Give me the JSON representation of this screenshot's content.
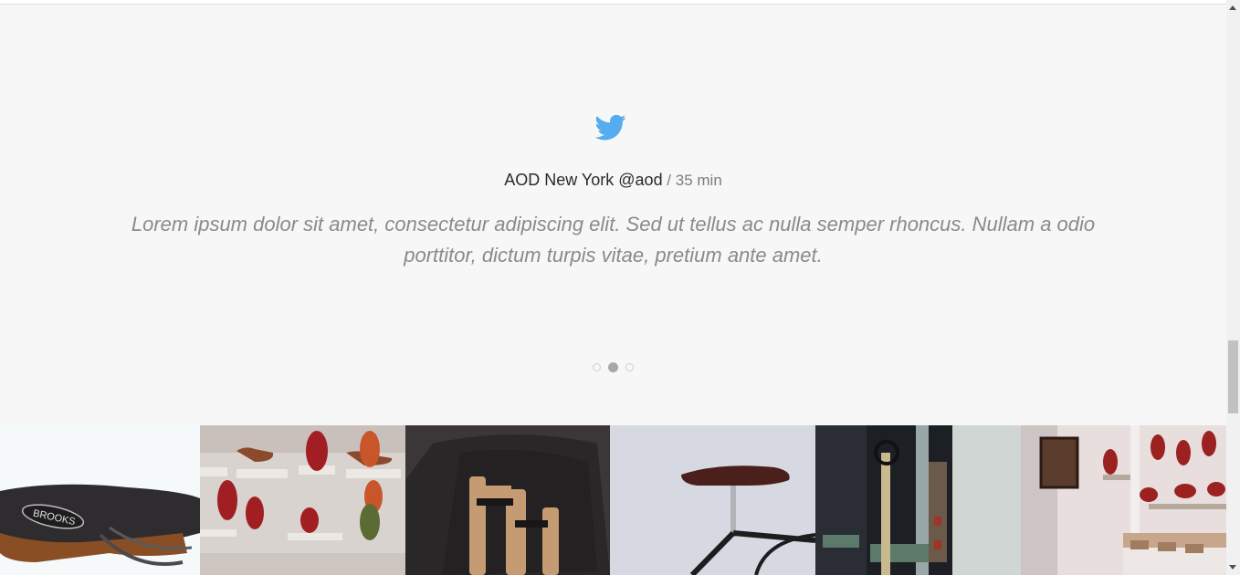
{
  "tweet": {
    "icon": "twitter-bird-icon",
    "author": "AOD New York @aod",
    "separator": " / ",
    "time": "35 min",
    "text": "Lorem ipsum dolor sit amet, consectetur adipiscing elit. Sed ut tellus ac nulla semper rhoncus. Nullam a odio porttitor, dictum turpis vitae, pretium ante amet.",
    "accent_color": "#55acee"
  },
  "carousel": {
    "total": 3,
    "active_index": 1
  },
  "gallery": {
    "items": [
      {
        "name": "saddle-closeup",
        "logo_text": "BROOKS"
      },
      {
        "name": "saddles-on-wall"
      },
      {
        "name": "leather-bag"
      },
      {
        "name": "bicycle-saddle"
      },
      {
        "name": "shop-interior"
      },
      {
        "name": "store-wall-display"
      }
    ]
  }
}
